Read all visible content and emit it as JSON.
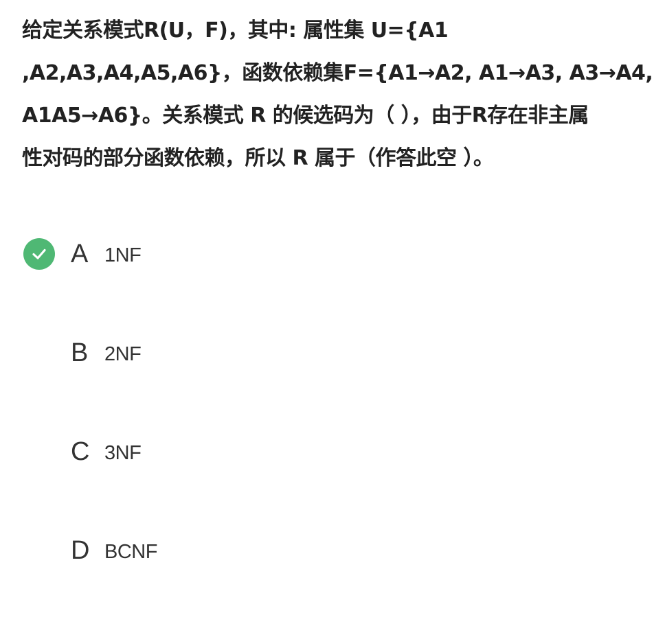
{
  "question": {
    "lines": [
      "给定关系模式R(U，F)，其中: 属性集 U={A1",
      ",A2,A3,A4,A5,A6}，函数依赖集F={A1→A2, A1→A3, A3→A4,",
      "A1A5→A6}。关系模式 R 的候选码为（ ），由于R存在非主属",
      "性对码的部分函数依赖，所以 R 属于（作答此空 ）。"
    ]
  },
  "options": [
    {
      "letter": "A",
      "text": "1NF",
      "correct": true
    },
    {
      "letter": "B",
      "text": "2NF",
      "correct": false
    },
    {
      "letter": "C",
      "text": "3NF",
      "correct": false
    },
    {
      "letter": "D",
      "text": "BCNF",
      "correct": false
    }
  ],
  "icons": {
    "correct": "check-circle-icon"
  },
  "colors": {
    "correct_green": "#4fb874",
    "text": "#222222"
  }
}
